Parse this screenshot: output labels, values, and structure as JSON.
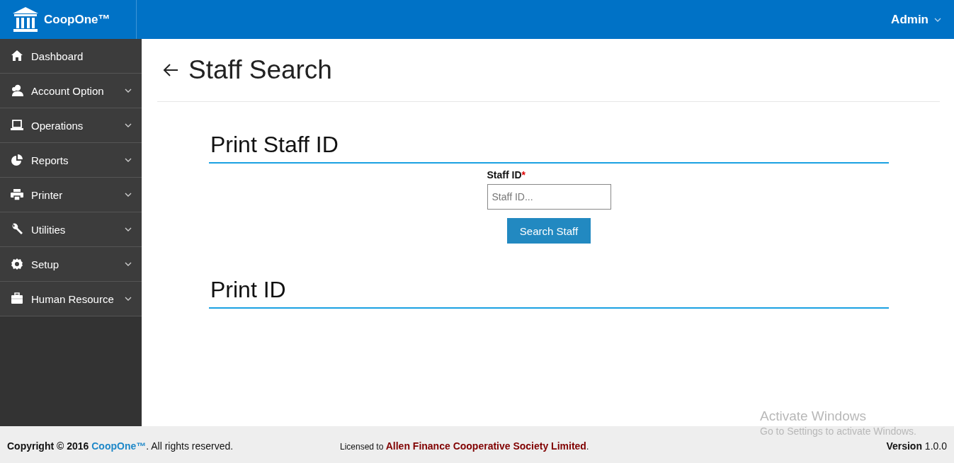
{
  "header": {
    "brand": "CoopOne™",
    "user_menu": "Admin"
  },
  "sidebar": {
    "items": [
      {
        "label": "Dashboard",
        "expandable": false
      },
      {
        "label": "Account Option",
        "expandable": true
      },
      {
        "label": "Operations",
        "expandable": true
      },
      {
        "label": "Reports",
        "expandable": true
      },
      {
        "label": "Printer",
        "expandable": true
      },
      {
        "label": "Utilities",
        "expandable": true
      },
      {
        "label": "Setup",
        "expandable": true
      },
      {
        "label": "Human Resource",
        "expandable": true
      }
    ]
  },
  "page": {
    "title": "Staff Search",
    "sections": [
      {
        "kind": "search",
        "heading": "Print Staff ID",
        "field_label": "Staff ID",
        "required_mark": "*",
        "placeholder": "Staff ID...",
        "button": "Search Staff"
      },
      {
        "kind": "plain",
        "heading": "Print ID"
      }
    ]
  },
  "footer": {
    "copyright_before": "Copyright © 2016",
    "copyright_link": "CoopOne™",
    "copyright_after": ". All rights reserved.",
    "license_prefix": "Licensed to",
    "licensee": "Allen Finance Cooperative Society Limited",
    "license_suffix": ".",
    "version": "**Version** 1.0.0"
  },
  "os_notice": {
    "title": "Activate Windows",
    "message": "Go to Settings to activate Windows."
  }
}
